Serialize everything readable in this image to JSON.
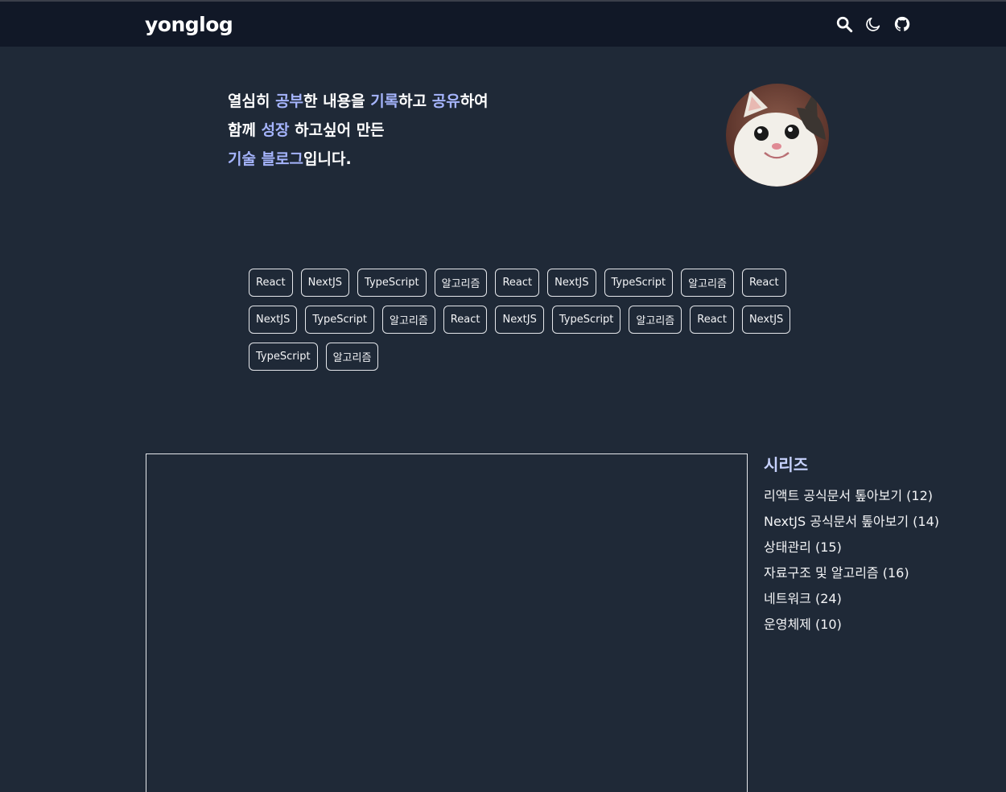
{
  "header": {
    "logo": "yonglog",
    "icons": [
      "search-icon",
      "moon-icon",
      "github-icon"
    ]
  },
  "intro": {
    "line1": [
      {
        "text": "열심히 ",
        "hl": false
      },
      {
        "text": "공부",
        "hl": true
      },
      {
        "text": "한 내용을 ",
        "hl": false
      },
      {
        "text": "기록",
        "hl": true
      },
      {
        "text": "하고 ",
        "hl": false
      },
      {
        "text": "공유",
        "hl": true
      },
      {
        "text": "하여",
        "hl": false
      }
    ],
    "line2": [
      {
        "text": "함께 ",
        "hl": false
      },
      {
        "text": "성장",
        "hl": true
      },
      {
        "text": " 하고싶어 만든",
        "hl": false
      }
    ],
    "line3": [
      {
        "text": "기술 블로그",
        "hl": true
      },
      {
        "text": "입니다.",
        "hl": false
      }
    ]
  },
  "avatar": {
    "alt": "cat-avatar"
  },
  "tags": [
    "React",
    "NextJS",
    "TypeScript",
    "알고리즘",
    "React",
    "NextJS",
    "TypeScript",
    "알고리즘",
    "React",
    "NextJS",
    "TypeScript",
    "알고리즘",
    "React",
    "NextJS",
    "TypeScript",
    "알고리즘",
    "React",
    "NextJS",
    "TypeScript",
    "알고리즘"
  ],
  "series": {
    "title": "시리즈",
    "items": [
      "리액트 공식문서 톺아보기 (12)",
      "NextJS 공식문서 톺아보기 (14)",
      "상태관리 (15)",
      "자료구조 및 알고리즘 (16)",
      "네트워크 (24)",
      "운영체제 (10)"
    ]
  },
  "colors": {
    "background": "#1f2937",
    "header": "#111827",
    "highlight": "#a5b4fc"
  }
}
